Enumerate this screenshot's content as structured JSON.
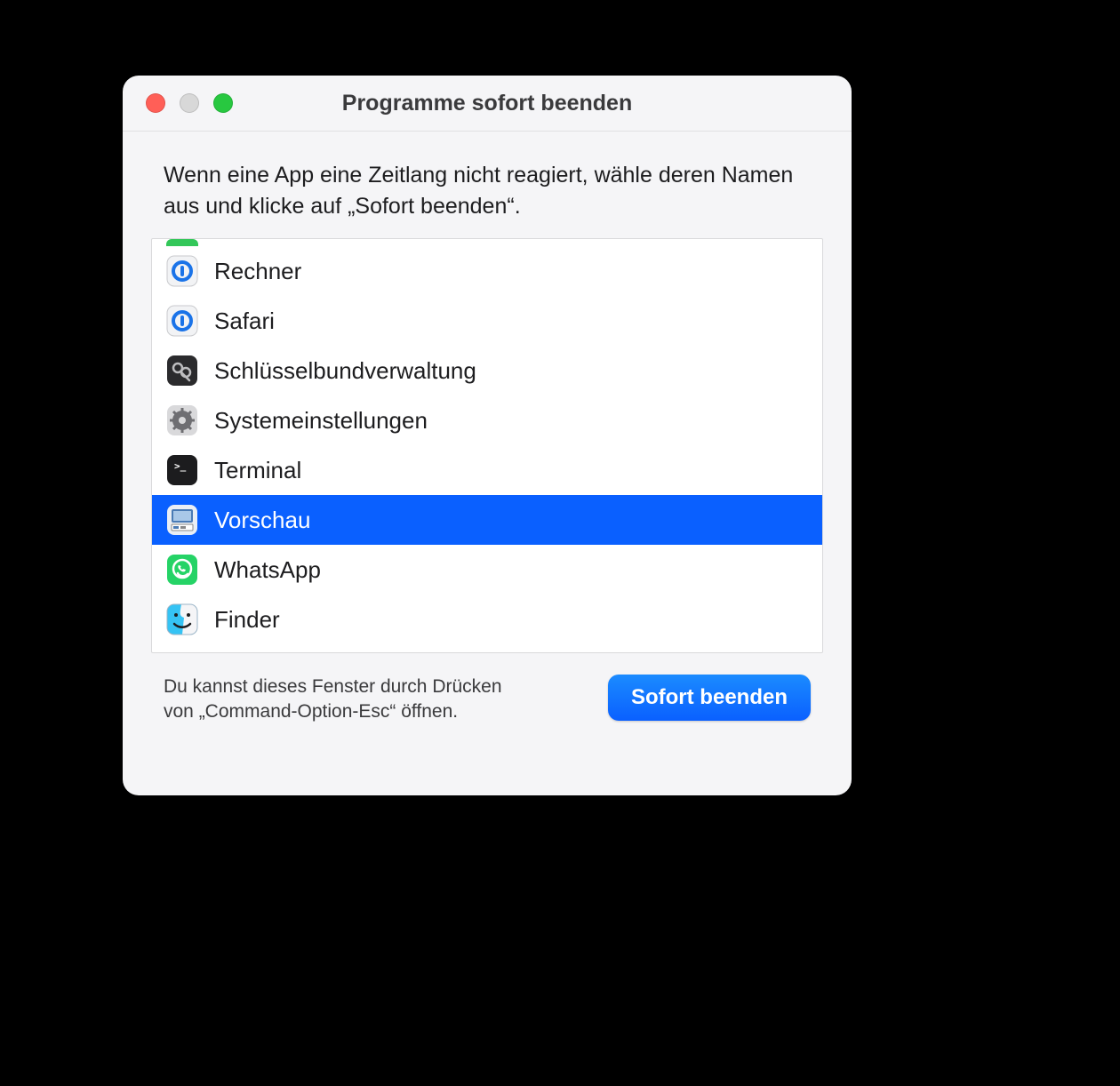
{
  "window": {
    "title": "Programme sofort beenden",
    "instruction": "Wenn eine App eine Zeitlang nicht reagiert, wähle deren Namen aus und klicke auf „Sofort beenden“.",
    "hint": "Du kannst dieses Fenster durch Drücken von „Command-Option-Esc“ öffnen.",
    "button_label": "Sofort beenden"
  },
  "apps": [
    {
      "label": "Rechner",
      "icon": "onepassword-icon",
      "selected": false
    },
    {
      "label": "Safari",
      "icon": "onepassword-icon",
      "selected": false
    },
    {
      "label": "Schlüsselbundverwaltung",
      "icon": "keychain-icon",
      "selected": false
    },
    {
      "label": "Systemeinstellungen",
      "icon": "settings-icon",
      "selected": false
    },
    {
      "label": "Terminal",
      "icon": "terminal-icon",
      "selected": false
    },
    {
      "label": "Vorschau",
      "icon": "preview-icon",
      "selected": true
    },
    {
      "label": "WhatsApp",
      "icon": "whatsapp-icon",
      "selected": false
    },
    {
      "label": "Finder",
      "icon": "finder-icon",
      "selected": false
    }
  ]
}
